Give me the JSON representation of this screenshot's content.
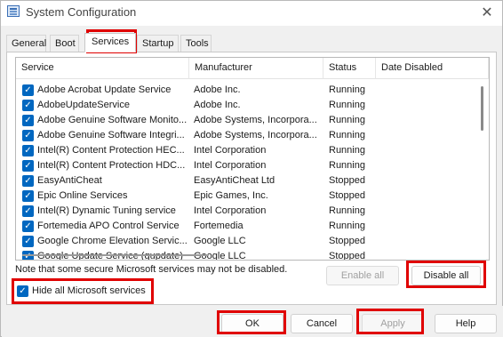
{
  "window": {
    "title": "System Configuration",
    "close_glyph": "✕",
    "icon": "msconfig-app-icon"
  },
  "tabs": [
    {
      "label": "General"
    },
    {
      "label": "Boot"
    },
    {
      "label": "Services",
      "selected": true
    },
    {
      "label": "Startup"
    },
    {
      "label": "Tools"
    }
  ],
  "table": {
    "columns": [
      "Service",
      "Manufacturer",
      "Status",
      "Date Disabled"
    ],
    "rows": [
      {
        "service": "Adobe Acrobat Update Service",
        "manufacturer": "Adobe Inc.",
        "status": "Running",
        "date_disabled": "",
        "checked": true
      },
      {
        "service": "AdobeUpdateService",
        "manufacturer": "Adobe Inc.",
        "status": "Running",
        "date_disabled": "",
        "checked": true
      },
      {
        "service": "Adobe Genuine Software Monito...",
        "manufacturer": "Adobe Systems, Incorpora...",
        "status": "Running",
        "date_disabled": "",
        "checked": true
      },
      {
        "service": "Adobe Genuine Software Integri...",
        "manufacturer": "Adobe Systems, Incorpora...",
        "status": "Running",
        "date_disabled": "",
        "checked": true
      },
      {
        "service": "Intel(R) Content Protection HEC...",
        "manufacturer": "Intel Corporation",
        "status": "Running",
        "date_disabled": "",
        "checked": true
      },
      {
        "service": "Intel(R) Content Protection HDC...",
        "manufacturer": "Intel Corporation",
        "status": "Running",
        "date_disabled": "",
        "checked": true
      },
      {
        "service": "EasyAntiCheat",
        "manufacturer": "EasyAntiCheat Ltd",
        "status": "Stopped",
        "date_disabled": "",
        "checked": true
      },
      {
        "service": "Epic Online Services",
        "manufacturer": "Epic Games, Inc.",
        "status": "Stopped",
        "date_disabled": "",
        "checked": true
      },
      {
        "service": "Intel(R) Dynamic Tuning service",
        "manufacturer": "Intel Corporation",
        "status": "Running",
        "date_disabled": "",
        "checked": true
      },
      {
        "service": "Fortemedia APO Control Service",
        "manufacturer": "Fortemedia",
        "status": "Running",
        "date_disabled": "",
        "checked": true
      },
      {
        "service": "Google Chrome Elevation Servic...",
        "manufacturer": "Google LLC",
        "status": "Stopped",
        "date_disabled": "",
        "checked": true
      },
      {
        "service": "Google Update Service (gupdate)",
        "manufacturer": "Google LLC",
        "status": "Stopped",
        "date_disabled": "",
        "checked": true
      }
    ]
  },
  "note": "Note that some secure Microsoft services may not be disabled.",
  "buttons": {
    "enable_all": "Enable all",
    "disable_all": "Disable all",
    "ok": "OK",
    "cancel": "Cancel",
    "apply": "Apply",
    "help": "Help"
  },
  "hide_ms": {
    "label": "Hide all Microsoft services",
    "checked": true
  },
  "check_glyph": "✓",
  "colors": {
    "checkbox": "#0067c0",
    "highlight": "#e00000"
  }
}
